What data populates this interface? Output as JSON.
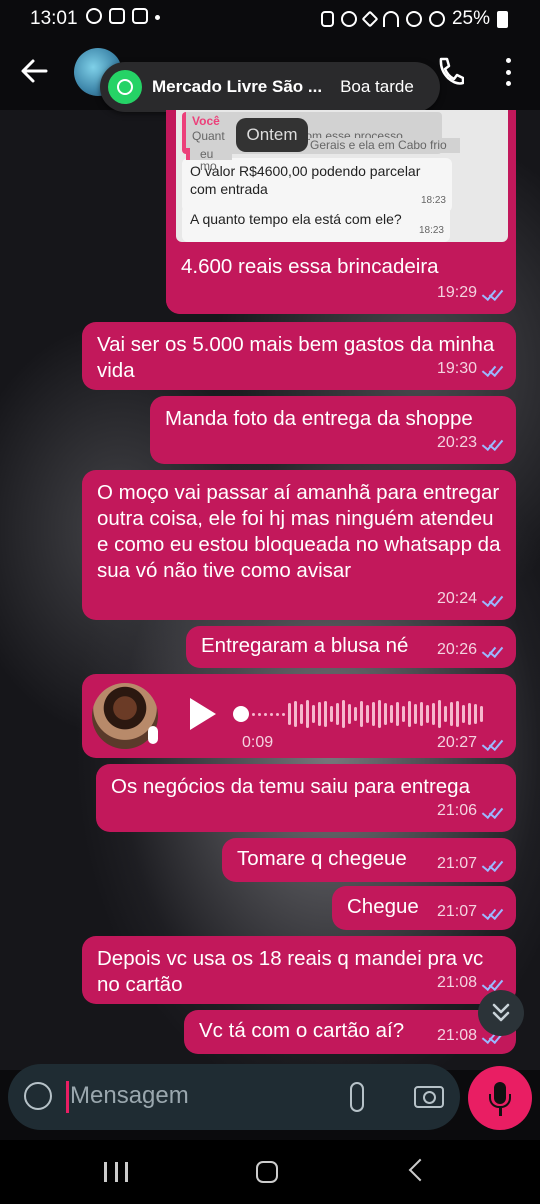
{
  "status_bar": {
    "time": "13:01",
    "battery": "25%"
  },
  "header": {
    "contact_name": "",
    "back_icon": "arrow-left-icon",
    "call_icon": "phone-icon",
    "menu_icon": "more-vertical-icon"
  },
  "notification": {
    "app": "WhatsApp",
    "title": "Mercado Livre São ...",
    "text": "Boa tarde"
  },
  "quoted_screenshot": {
    "quote_author": "Você",
    "quote_line1": "Quant",
    "quote_line1b": "trar com esse processo",
    "quote_line2": "eu mo",
    "quote_line2b": "Gerais e ela em Cabo frio",
    "msg1": "O valor R$4600,00 podendo parcelar com entrada",
    "msg1_time": "18:23",
    "msg2": "A quanto tempo ela está com ele?",
    "msg2_time": "18:23",
    "date_chip": "Ontem"
  },
  "messages": [
    {
      "text": "4.600 reais essa brincadeira",
      "time": "19:29"
    },
    {
      "text": "Vai ser os 5.000 mais bem gastos da minha vida",
      "time": "19:30"
    },
    {
      "text": "Manda foto da entrega da shoppe",
      "time": "20:23"
    },
    {
      "text": "O moço vai passar aí amanhã para entregar outra coisa, ele foi hj mas ninguém atendeu e como eu estou bloqueada no whatsapp da sua vó não tive como avisar",
      "time": "20:24"
    },
    {
      "text": "Entregaram a blusa né",
      "time": "20:26"
    },
    {
      "text": "Os negócios da temu saiu para entrega",
      "time": "21:06"
    },
    {
      "text": "Tomare q chegeue",
      "time": "21:07"
    },
    {
      "text": "Chegue",
      "time": "21:07"
    },
    {
      "text": "Depois vc usa os 18 reais q mandei pra vc no cartão",
      "time": "21:08"
    },
    {
      "text": "Vc tá com o cartão aí?",
      "time": "21:08"
    }
  ],
  "voice_note": {
    "duration": "0:09",
    "time": "20:27",
    "progress": 0
  },
  "composer": {
    "placeholder": "Mensagem"
  },
  "colors": {
    "bubble": "#c2185b",
    "accent": "#e91e63",
    "whatsapp": "#25d366",
    "ticks": "#9bb8ff"
  }
}
